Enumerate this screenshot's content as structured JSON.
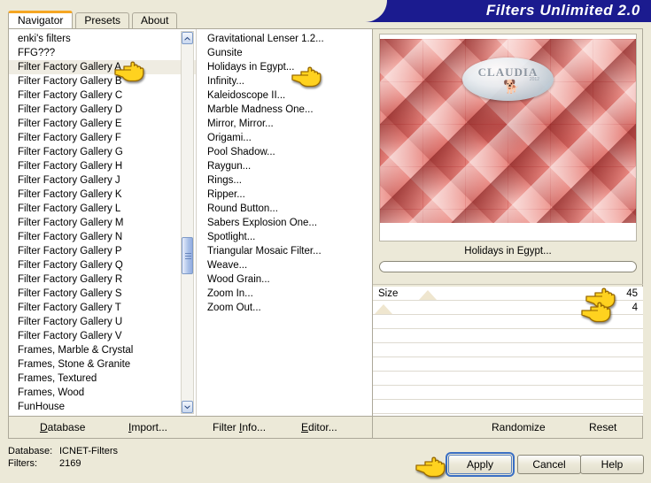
{
  "window": {
    "banner_title": "Filters Unlimited 2.0"
  },
  "tabs": [
    {
      "label": "Navigator",
      "active": true
    },
    {
      "label": "Presets",
      "active": false
    },
    {
      "label": "About",
      "active": false
    }
  ],
  "category_list": {
    "scroll_up_icon": "chevron-up-icon",
    "scroll_down_icon": "chevron-down-icon",
    "items": [
      "enki's filters",
      "FFG???",
      "Filter Factory Gallery A",
      "Filter Factory Gallery B",
      "Filter Factory Gallery C",
      "Filter Factory Gallery D",
      "Filter Factory Gallery E",
      "Filter Factory Gallery F",
      "Filter Factory Gallery G",
      "Filter Factory Gallery H",
      "Filter Factory Gallery J",
      "Filter Factory Gallery K",
      "Filter Factory Gallery L",
      "Filter Factory Gallery M",
      "Filter Factory Gallery N",
      "Filter Factory Gallery P",
      "Filter Factory Gallery Q",
      "Filter Factory Gallery R",
      "Filter Factory Gallery S",
      "Filter Factory Gallery T",
      "Filter Factory Gallery U",
      "Filter Factory Gallery V",
      "Frames, Marble & Crystal",
      "Frames, Stone & Granite",
      "Frames, Textured",
      "Frames, Wood",
      "FunHouse"
    ],
    "highlighted": "Filter Factory Gallery A"
  },
  "filter_list": {
    "items": [
      "Gravitational Lenser 1.2...",
      "Gunsite",
      "Holidays in Egypt...",
      "Infinity...",
      "Kaleidoscope II...",
      "Marble Madness One...",
      "Mirror, Mirror...",
      "Origami...",
      "Pool Shadow...",
      "Raygun...",
      "Rings...",
      "Ripper...",
      "Round Button...",
      "Sabers Explosion One...",
      "Spotlight...",
      "Triangular Mosaic Filter...",
      "Weave...",
      "Wood Grain...",
      "Zoom In...",
      "Zoom Out..."
    ],
    "selected": "Holidays in Egypt..."
  },
  "preview": {
    "caption": "Holidays in Egypt...",
    "progress_value": ""
  },
  "sliders": [
    {
      "label": "Size",
      "value": "45"
    },
    {
      "label": "",
      "value": "4"
    },
    {
      "label": "",
      "value": ""
    },
    {
      "label": "",
      "value": ""
    },
    {
      "label": "",
      "value": ""
    },
    {
      "label": "",
      "value": ""
    },
    {
      "label": "",
      "value": ""
    },
    {
      "label": "",
      "value": ""
    },
    {
      "label": "",
      "value": ""
    }
  ],
  "watermark": {
    "text": "CLAUDIA",
    "subtext": "2012",
    "glyph": "ὁ5"
  },
  "toolbar": {
    "database_label": "Database",
    "database_accel": "D",
    "import_label": "Import...",
    "import_accel": "I",
    "filter_info_label": "Filter Info...",
    "filter_info_accel": "I",
    "editor_label": "Editor...",
    "editor_accel": "E",
    "randomize_label": "Randomize",
    "reset_label": "Reset"
  },
  "status": {
    "database_key": "Database:",
    "database_value": "ICNET-Filters",
    "filters_key": "Filters:",
    "filters_value": "2169"
  },
  "buttons": {
    "apply_label": "Apply",
    "cancel_label": "Cancel",
    "help_label": "Help"
  },
  "colors": {
    "banner_blue": "#1b1b8f",
    "accent_orange": "#f5a623",
    "selection_blue": "#1043a8",
    "window_beige": "#ece9d8",
    "preview_red": "#e98b84",
    "cursor_yellow": "#ffcc00"
  }
}
